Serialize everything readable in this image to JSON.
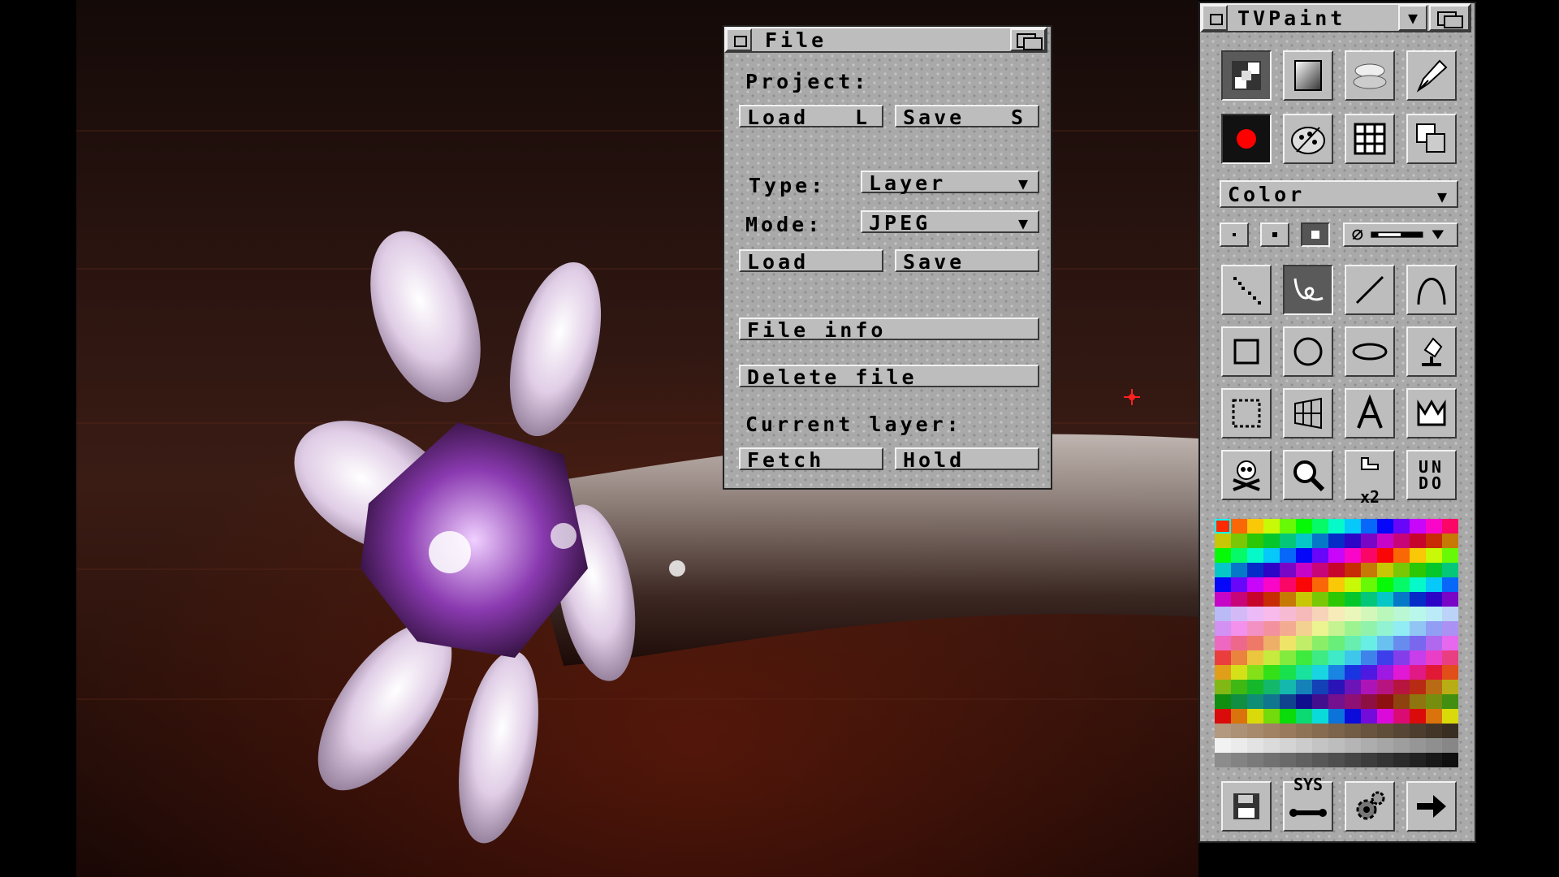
{
  "file_window": {
    "title": "File",
    "project_label": "Project:",
    "load_label": "Load",
    "load_key": "L",
    "save_label": "Save",
    "save_key": "S",
    "type_label": "Type:",
    "type_value": "Layer",
    "mode_label": "Mode:",
    "mode_value": "JPEG",
    "load2_label": "Load",
    "save2_label": "Save",
    "file_info_label": "File info",
    "delete_file_label": "Delete file",
    "current_layer_label": "Current layer:",
    "fetch_label": "Fetch",
    "hold_label": "Hold"
  },
  "toolbox": {
    "title": "TVPaint",
    "color_mode": "Color",
    "tools_row1": [
      "checker-icon",
      "gradient-icon",
      "airbrush-cloud-icon",
      "pen-nib-icon"
    ],
    "tools_row2": [
      "record-dot-icon",
      "palette-icon",
      "grid-icon",
      "layers-icon"
    ],
    "draw_tools": [
      [
        "dotted-line-icon",
        "freehand-icon",
        "line-icon",
        "curve-icon"
      ],
      [
        "rectangle-icon",
        "circle-icon",
        "ellipse-icon",
        "fill-icon"
      ],
      [
        "selection-icon",
        "perspective-icon",
        "text-icon",
        "crown-icon"
      ],
      [
        "skull-icon",
        "magnify-icon",
        "zoom-x2-icon",
        "undo-icon"
      ]
    ],
    "x2_label": "x2",
    "undo_label": "UNDO",
    "sys_label": "SYS",
    "accent_red": "#ff0000",
    "selected_color": "#ff2a00"
  }
}
